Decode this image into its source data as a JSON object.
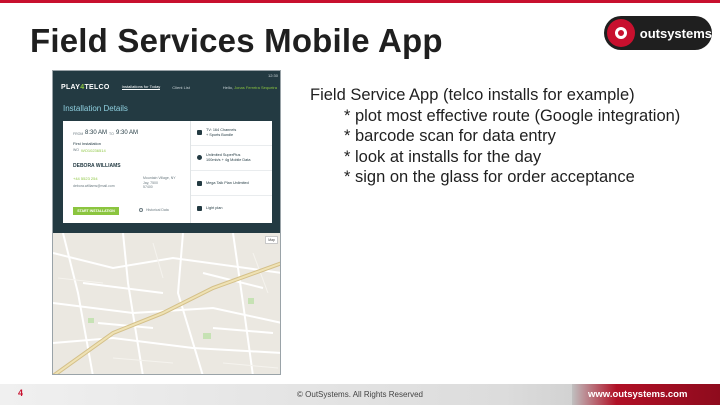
{
  "slide": {
    "title": "Field Services Mobile App",
    "page_number": "4"
  },
  "logo": {
    "text": "outsystems"
  },
  "bullets": {
    "lead": "Field Service App (telco installs for example)",
    "items": [
      "* plot most effective route (Google integration)",
      "* barcode scan for data entry",
      "* look at installs for the day",
      "* sign on the glass for order acceptance"
    ]
  },
  "app": {
    "status_time": "12:30",
    "brand_prefix": "PLAY",
    "brand_four": "4",
    "brand_suffix": "TELCO",
    "nav": [
      "Installations for Today",
      "Client List"
    ],
    "user_prefix": "Hello, ",
    "user_name": "Jonas Ferreira Sequeira",
    "section_title": "Installation Details",
    "from_label": "FROM",
    "from_time": "8:30 AM",
    "to_label": "TO",
    "to_time": "9:30 AM",
    "install_type": "First Installation",
    "wo_label": "WO",
    "wo_number": "WO10236514",
    "customer_name": "DEBORA WILLIAMS",
    "phone": "+44 5523 254",
    "email": "debora.williams@mail.com",
    "address": "Mountain Village, NY\nJay, 7500\n57400",
    "start_button": "START INSTALLATION",
    "history_label": "Historical Data",
    "services": [
      "TV: 164 Channels\n+ Sports Bundle",
      "Unlimited SuperPlus\n100mb/s + 4g Mobile Data",
      "Mega Talk Plan Unlimited",
      "Light plan"
    ],
    "map_control": "Map"
  },
  "footer": {
    "copyright": "© OutSystems. All Rights Reserved",
    "url": "www.outsystems.com"
  },
  "colors": {
    "accent_red": "#c8102e",
    "app_dark": "#233a42",
    "app_green": "#8bc53f"
  }
}
